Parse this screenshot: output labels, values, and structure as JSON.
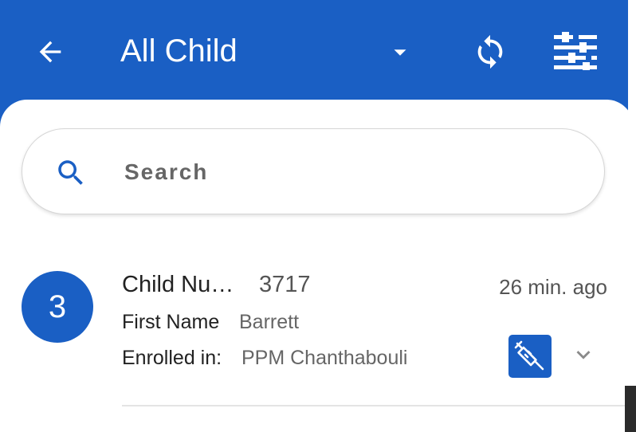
{
  "header": {
    "title": "All Child",
    "icons": {
      "back": "arrow-left-icon",
      "dropdown": "caret-down-icon",
      "sync": "sync-icon",
      "filter": "filter-sliders-icon"
    }
  },
  "search": {
    "placeholder": "Search",
    "value": "",
    "icon": "search-icon"
  },
  "list": {
    "items": [
      {
        "avatar_text": "3",
        "title_label": "Child Number",
        "title_value": "3717",
        "time": "26 min. ago",
        "first_name_label": "First Name",
        "first_name_value": "Barrett",
        "enrolled_label": "Enrolled in:",
        "enrolled_value": "PPM Chanthabouli",
        "badge_icon": "syringe-icon",
        "expand_icon": "chevron-down-icon"
      }
    ]
  },
  "colors": {
    "primary": "#1a5fc4",
    "surface": "#ffffff",
    "text_primary": "#222222",
    "text_secondary": "#666666"
  }
}
